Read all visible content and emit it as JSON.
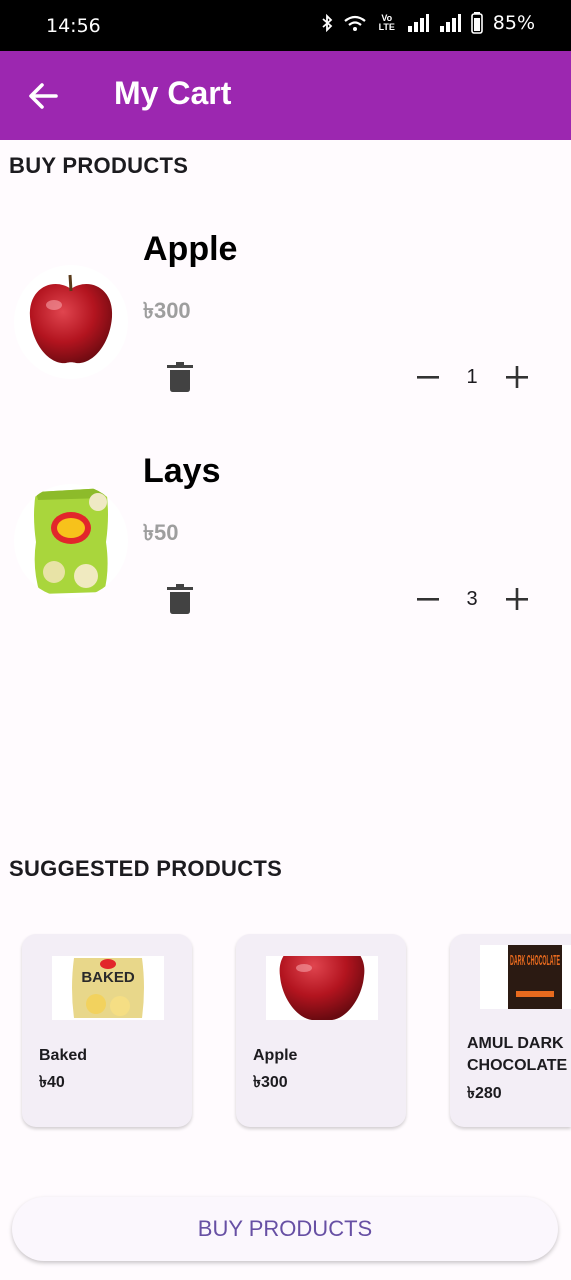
{
  "status_bar": {
    "time": "14:56",
    "battery": "85%",
    "volte": "Vo LTE"
  },
  "app_bar": {
    "title": "My Cart"
  },
  "cart": {
    "heading": "BUY PRODUCTS",
    "items": [
      {
        "name": "Apple",
        "price": "৳300",
        "quantity": "1"
      },
      {
        "name": "Lays",
        "price": "৳50",
        "quantity": "3"
      }
    ]
  },
  "suggested": {
    "heading": "SUGGESTED PRODUCTS",
    "items": [
      {
        "name": "Baked",
        "price": "৳40",
        "image_text": "BAKED"
      },
      {
        "name": "Apple",
        "price": "৳300"
      },
      {
        "name": "AMUL DARK CHOCOLATE",
        "price": "৳280",
        "image_text": "DARK CHOCOLATE"
      }
    ]
  },
  "buy_button": {
    "label": "BUY PRODUCTS"
  },
  "colors": {
    "app_bar": "#9c27b0",
    "button_text": "#6750a4",
    "price_grey": "#9e9e9e"
  }
}
